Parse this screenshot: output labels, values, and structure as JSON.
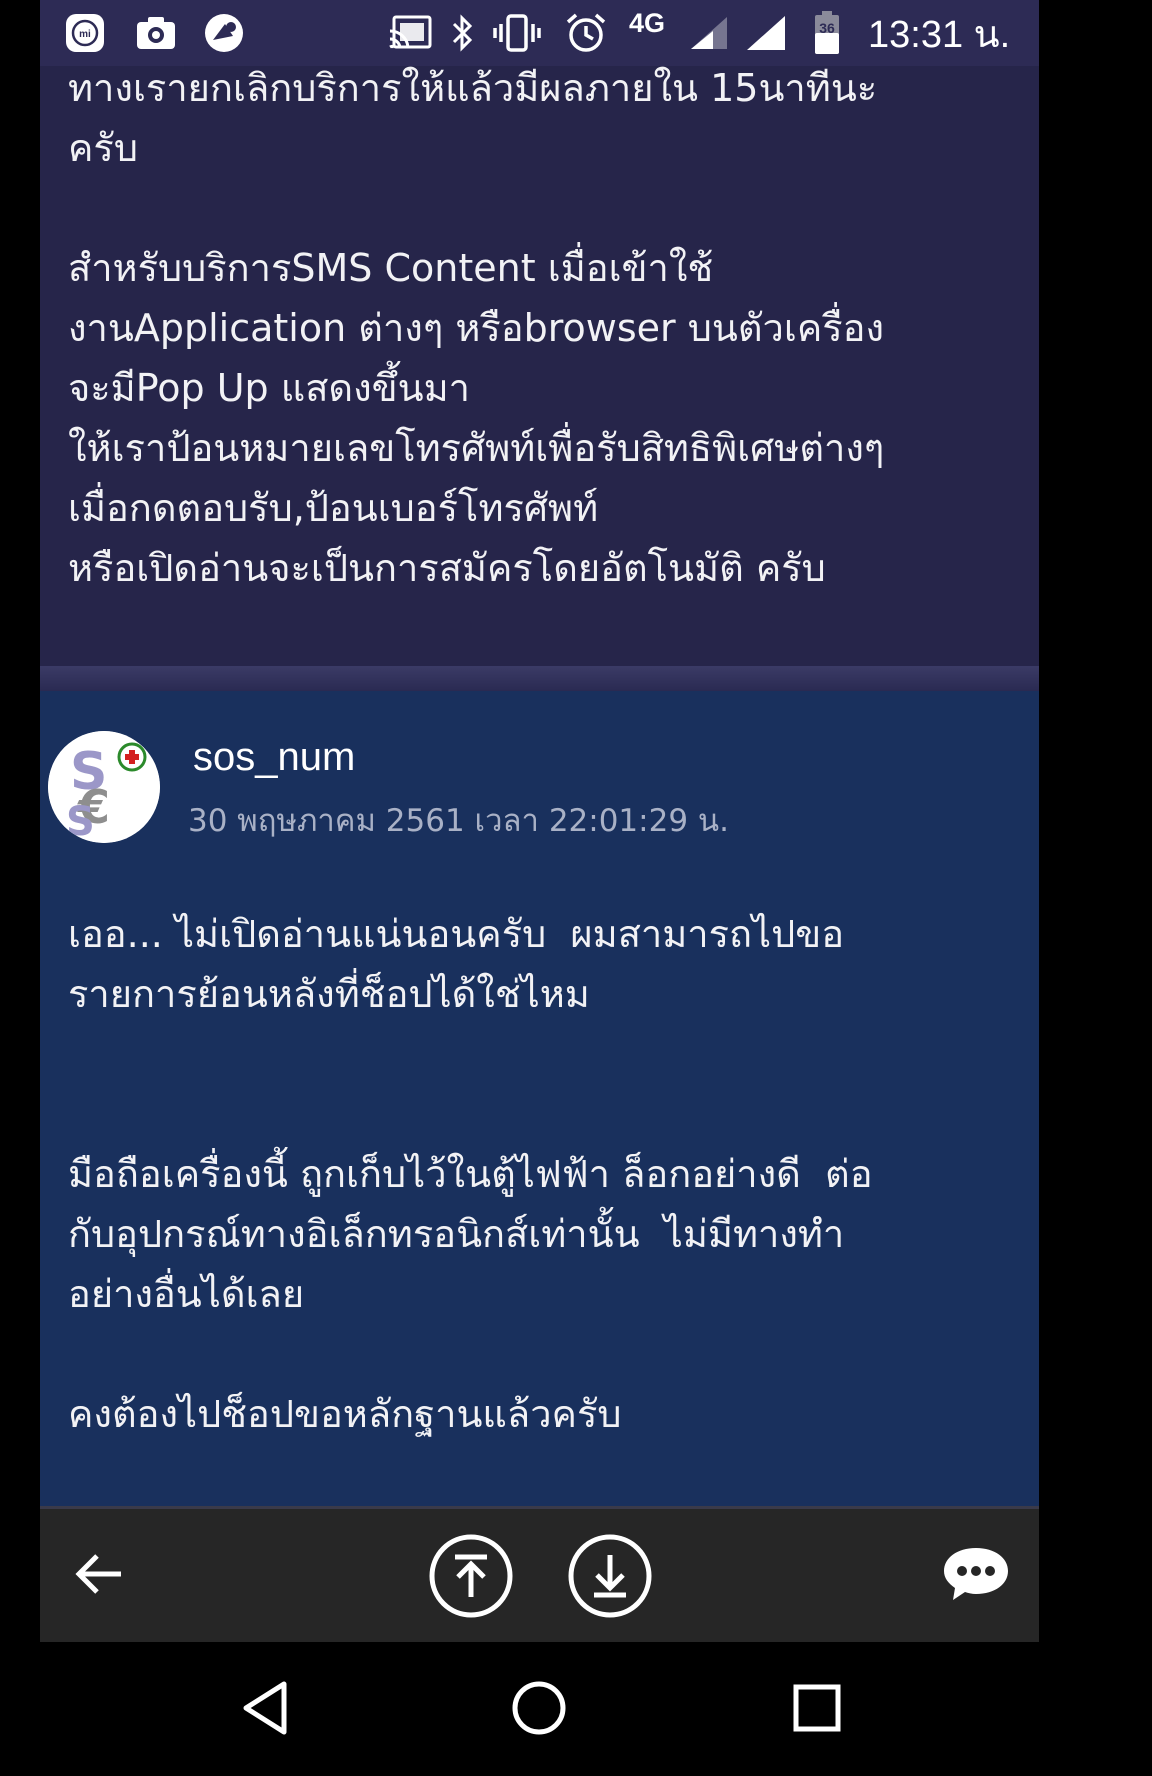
{
  "status_bar": {
    "time": "13:31 น.",
    "network": "4G",
    "battery_level": "36",
    "icons": [
      "mi-icon",
      "camera-icon",
      "app-icon",
      "cast-icon",
      "bluetooth-icon",
      "vibrate-icon",
      "alarm-icon",
      "signal-icon",
      "signal-icon",
      "battery-icon"
    ]
  },
  "post_previous": {
    "body": "ทางเรายกเลิกบริการให้แล้วมีผลภายใน 15นาทีนะ\nครับ\n\nสำหรับบริการSMS Content เมื่อเข้าใช้\nงานApplication ต่างๆ หรือbrowser บนตัวเครื่อง\nจะมีPop Up แสดงขึ้นมา\nให้เราป้อนหมายเลขโทรศัพท์เพื่อรับสิทธิพิเศษต่างๆ\nเมื่อกดตอบรับ,ป้อนเบอร์โทรศัพท์\nหรือเปิดอ่านจะเป็นการสมัครโดยอัตโนมัติ ครับ"
  },
  "post_reply": {
    "username": "sos_num",
    "timestamp": "30 พฤษภาคม 2561 เวลา 22:01:29 น.",
    "body": "เออ... ไม่เปิดอ่านแน่นอนครับ  ผมสามารถไปขอ\nรายการย้อนหลังที่ช็อปได้ใช่ไหม\n\n\nมือถือเครื่องนี้ ถูกเก็บไว้ในตู้ไฟฟ้า ล็อกอย่างดี  ต่อ\nกับอุปกรณ์ทางอิเล็กทรอนิกส์เท่านั้น  ไม่มีทางทำ\nอย่างอื่นได้เลย\n\nคงต้องไปช็อปขอหลักฐานแล้วครับ"
  },
  "toolbar": {
    "icons": [
      "back-arrow-icon",
      "scroll-top-icon",
      "scroll-bottom-icon",
      "chat-icon"
    ]
  },
  "nav_bar": {
    "icons": [
      "nav-back-icon",
      "nav-home-icon",
      "nav-recents-icon"
    ]
  },
  "colors": {
    "status_bar": "#2d2b55",
    "post_previous_bg": "#26254a",
    "post_reply_bg": "#19305d",
    "toolbar_bg": "#262626",
    "text": "#f2f2f5",
    "timestamp": "#a9b1c6"
  }
}
